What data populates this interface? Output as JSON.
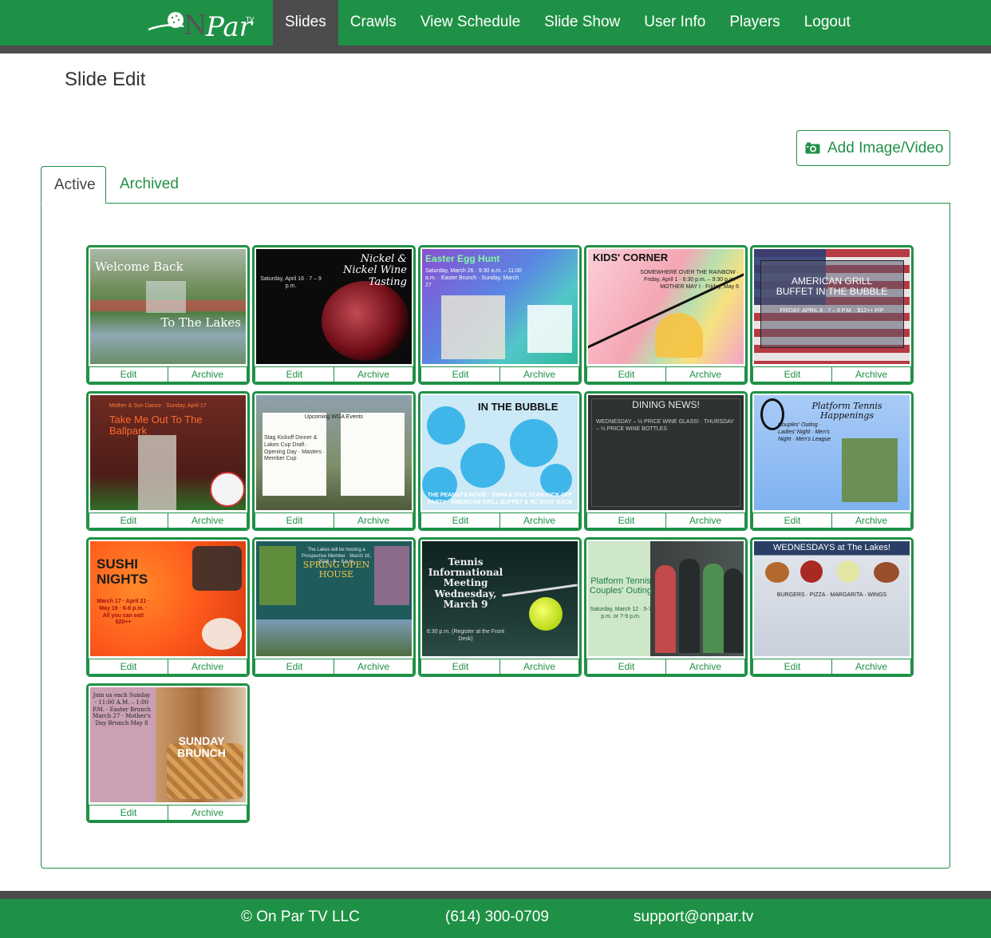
{
  "brand": {
    "logo_text": "OnPar",
    "logo_tv": "TV"
  },
  "nav": {
    "items": [
      {
        "label": "Slides",
        "active": true
      },
      {
        "label": "Crawls",
        "active": false
      },
      {
        "label": "View Schedule",
        "active": false
      },
      {
        "label": "Slide Show",
        "active": false
      },
      {
        "label": "User Info",
        "active": false
      },
      {
        "label": "Players",
        "active": false
      },
      {
        "label": "Logout",
        "active": false
      }
    ]
  },
  "page": {
    "title": "Slide Edit",
    "add_button_label": "Add Image/Video"
  },
  "tabs": {
    "active_label": "Active",
    "archived_label": "Archived"
  },
  "card_actions": {
    "edit": "Edit",
    "archive": "Archive"
  },
  "slides": [
    {
      "title": "Welcome Back",
      "subtitle": "To The Lakes"
    },
    {
      "title": "Nickel & Nickel Wine Tasting",
      "subtitle": "Saturday, April 16 · 7 – 9 p.m."
    },
    {
      "title": "Easter Egg Hunt",
      "subtitle": "Saturday, March 26 · 9:30 a.m. – 11:00 a.m. · Easter Brunch · Sunday, March 27"
    },
    {
      "title": "KIDS' CORNER",
      "subtitle": "SOMEWHERE OVER THE RAINBOW · Friday, April 1 · 6:30 p.m. – 9:30 p.m. · MOTHER MAY I · Friday, May 6"
    },
    {
      "title": "AMERICAN GRILL BUFFET IN THE BUBBLE",
      "subtitle": "FRIDAY, APRIL 8 · 7 – 9 P.M. · $12++ P/P"
    },
    {
      "title": "Take Me Out To The Ballpark",
      "subtitle": "Mother & Son Dance · Sunday, April 17"
    },
    {
      "title": "Upcoming WGA Events",
      "subtitle": "Stag Kickoff Dinner & Lakes Cup Draft · Opening Day · Masters · Member Cup"
    },
    {
      "title": "IN THE BUBBLE",
      "subtitle": "THE PEANUTS MOVIE · SWIM & DIVE TEAM KICK OFF PARTY · AMERICAN GRILL BUFFET & RC BOAT RACE"
    },
    {
      "title": "DINING NEWS!",
      "subtitle": "WEDNESDAY – ½ PRICE WINE GLASS! · THURSDAY – ½ PRICE WINE BOTTLES"
    },
    {
      "title": "Platform Tennis Happenings",
      "subtitle": "Couples' Outing · Ladies' Night · Men's Night · Men's League"
    },
    {
      "title": "SUSHI NIGHTS",
      "subtitle": "March 17 · April 21 · May 19 · 6-8 p.m. · All you can eat! $20++"
    },
    {
      "title": "SPRING OPEN HOUSE",
      "subtitle": "The Lakes will be hosting a Prospective Member · March 16, 2016 · 6 – 8 p.m."
    },
    {
      "title": "Tennis Informational Meeting Wednesday, March 9",
      "subtitle": "6:30 p.m. (Register at the Front Desk)"
    },
    {
      "title": "Platform Tennis Couples' Outing",
      "subtitle": "Saturday, March 12 · 5-7 p.m. or 7-9 p.m."
    },
    {
      "title": "WEDNESDAYS at The Lakes!",
      "subtitle": "BURGERS · PIZZA · MARGARITA · WINGS"
    },
    {
      "title": "SUNDAY BRUNCH",
      "subtitle": "Join us each Sunday · 11:00 A.M. – 1:00 P.M. · Easter Brunch March 27 · Mother's Day Brunch May 8"
    }
  ],
  "footer": {
    "company": "© On Par TV LLC",
    "phone": "(614) 300-0709",
    "email": "support@onpar.tv"
  },
  "colors": {
    "brand_green": "#1f9146",
    "nav_dark": "#4c4c4c"
  }
}
